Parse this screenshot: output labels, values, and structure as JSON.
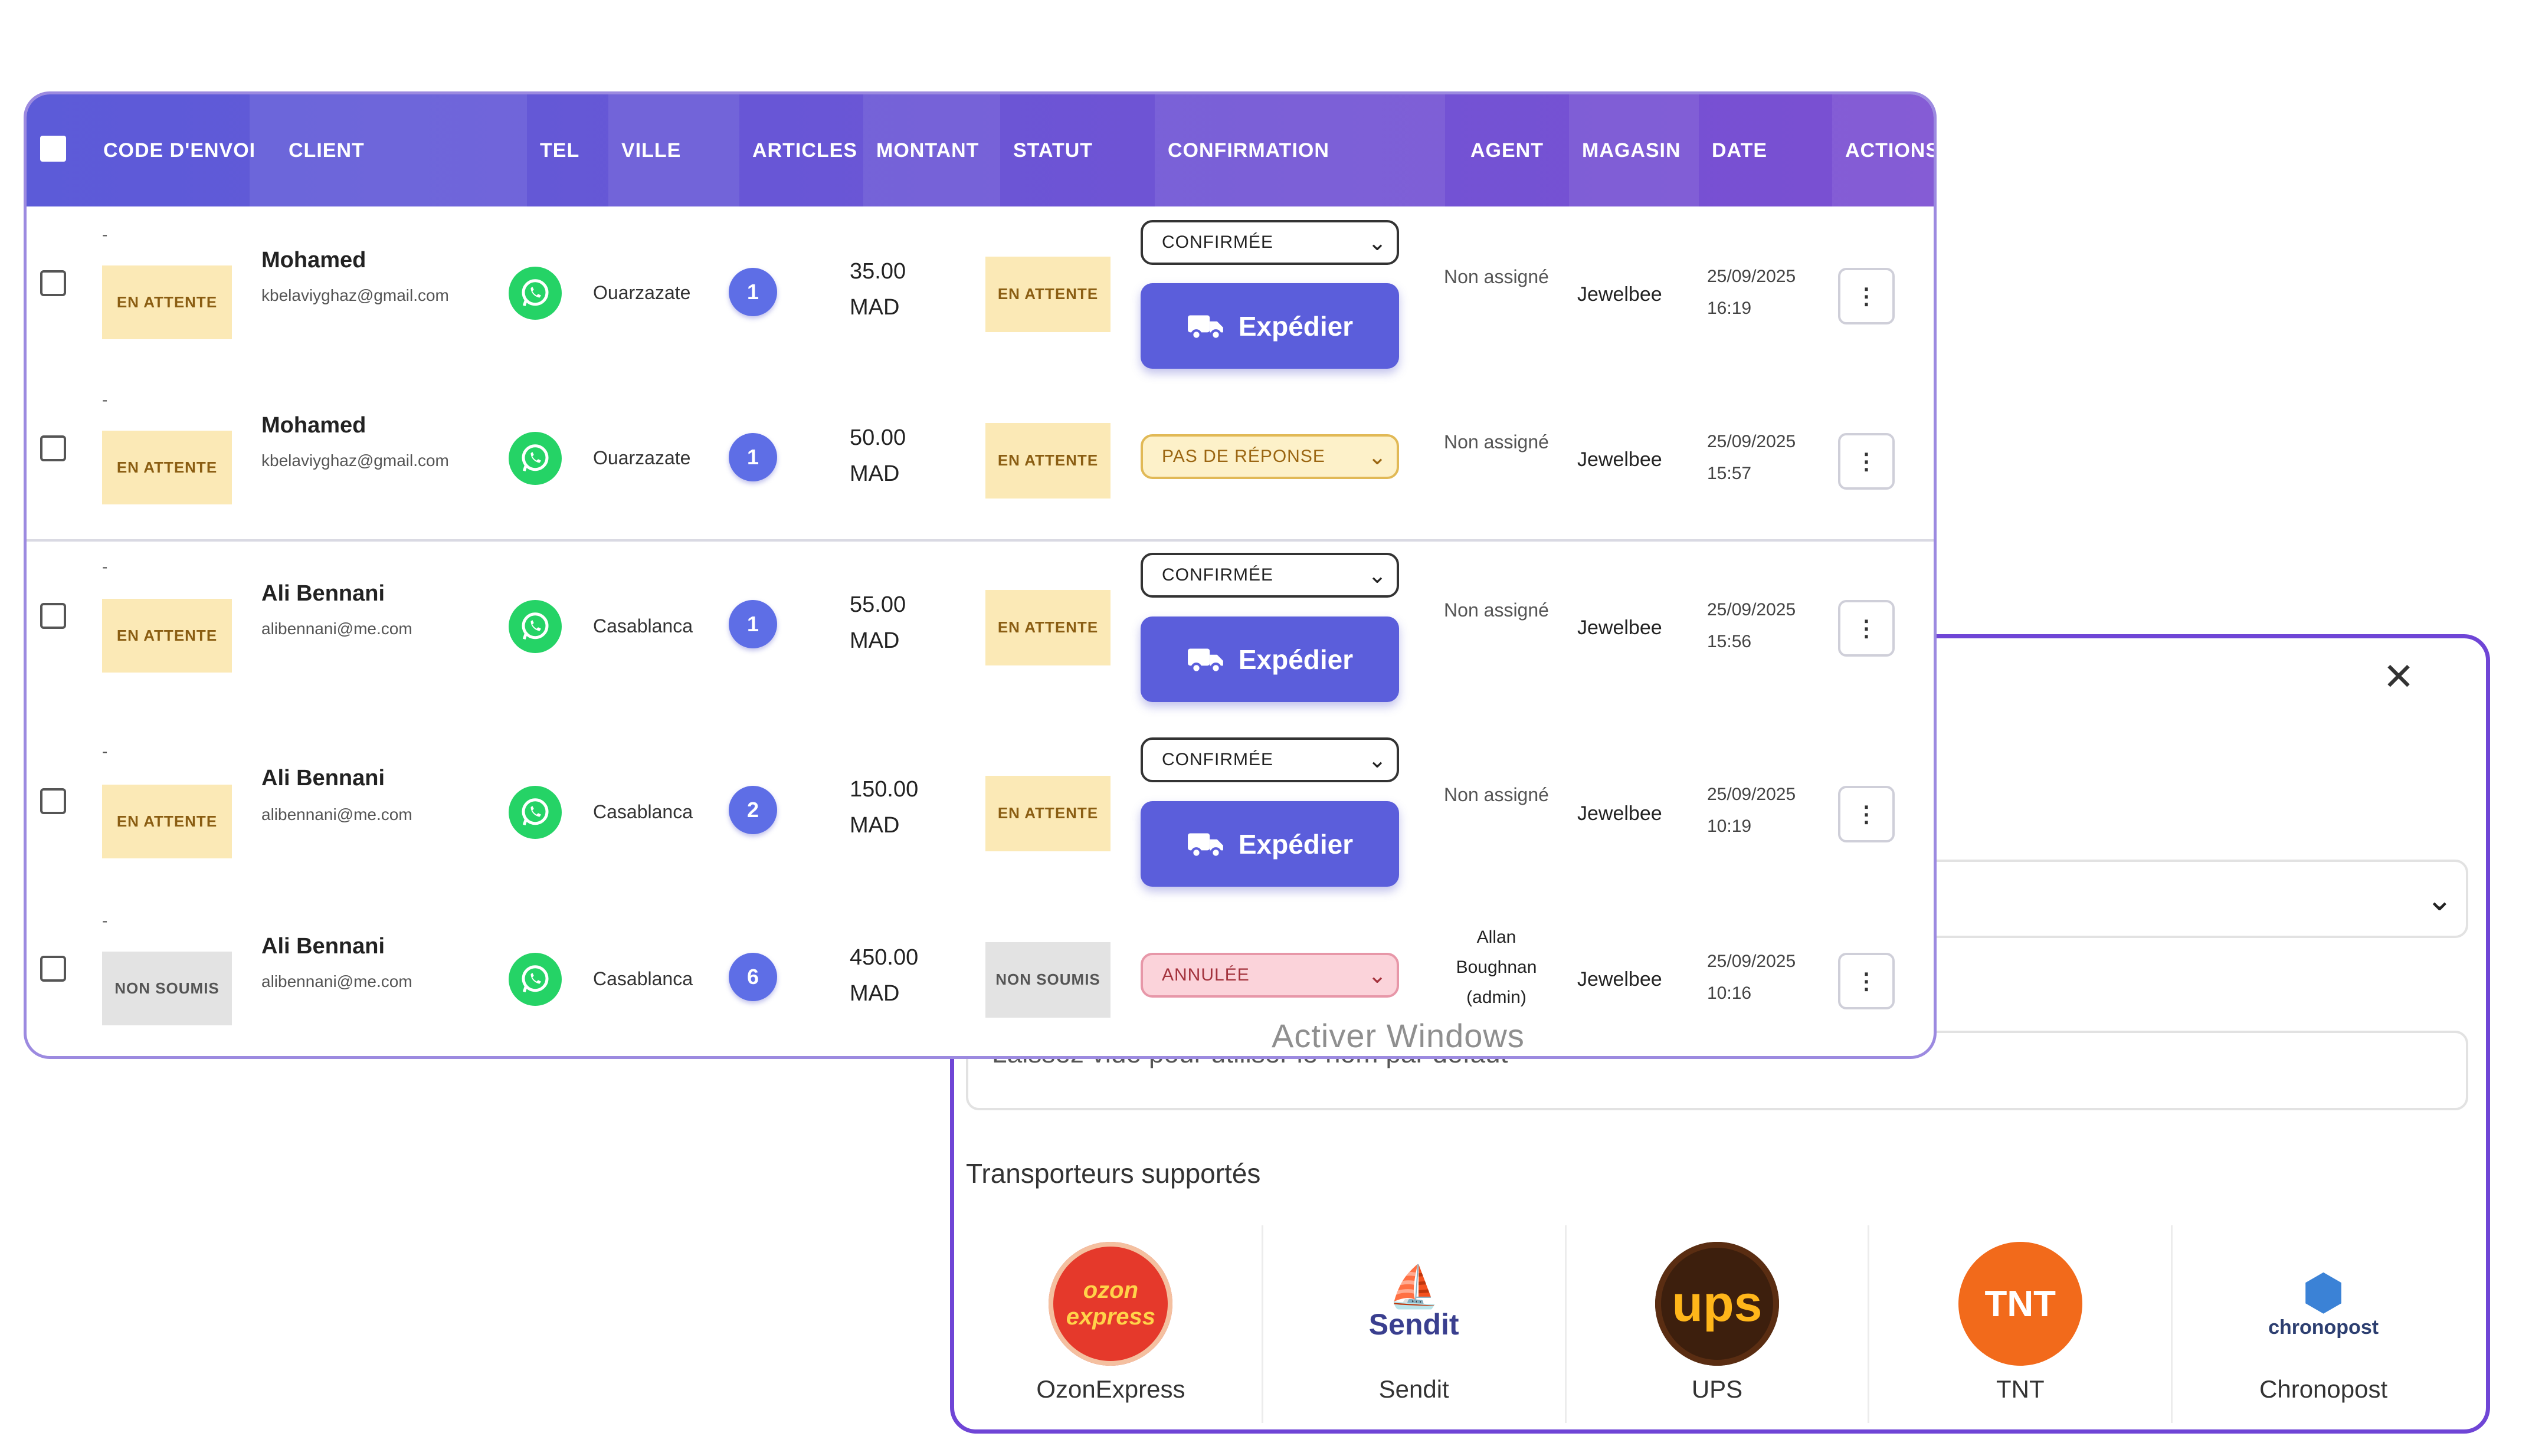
{
  "modal": {
    "close_icon": "close-icon",
    "name_placeholder": "Laissez vide pour utiliser le nom par défaut",
    "carriers_label": "Transporteurs supportés",
    "carriers": [
      {
        "name": "OzonExpress",
        "logo_text": "ozon express",
        "color": "#e5392b"
      },
      {
        "name": "Sendit",
        "logo_text": "Sendit",
        "color": "#3a3f8f"
      },
      {
        "name": "UPS",
        "logo_text": "ups",
        "color": "#5a2d12"
      },
      {
        "name": "TNT",
        "logo_text": "TNT",
        "color": "#f26a1b"
      },
      {
        "name": "Chronopost",
        "logo_text": "chronopost",
        "color": "#2c68c8"
      }
    ]
  },
  "table": {
    "headers": {
      "code": "Code d'envoi",
      "client": "Client",
      "tel": "Tel",
      "ville": "Ville",
      "articles": "Articles",
      "montant": "Montant",
      "statut": "Statut",
      "confirmation": "Confirmation",
      "agent": "Agent",
      "magasin": "Magasin",
      "date": "Date",
      "actions": "Actions"
    },
    "rows": [
      {
        "code": "-",
        "code_badge": "En attente",
        "name": "Mohamed",
        "email": "kbelaviyghaz@gmail.com",
        "city": "Ouarzazate",
        "articles": "1",
        "amount": "35.00",
        "currency": "MAD",
        "status": "En attente",
        "confirmation": "Confirmée",
        "ship_label": "Expédier",
        "agent": "Non assigné",
        "store": "Jewelbee",
        "date": "25/09/2025",
        "time": "16:19"
      },
      {
        "code": "-",
        "code_badge": "En attente",
        "name": "Mohamed",
        "email": "kbelaviyghaz@gmail.com",
        "city": "Ouarzazate",
        "articles": "1",
        "amount": "50.00",
        "currency": "MAD",
        "status": "En attente",
        "confirmation": "Pas de réponse",
        "agent": "Non assigné",
        "store": "Jewelbee",
        "date": "25/09/2025",
        "time": "15:57"
      },
      {
        "code": "-",
        "code_badge": "En attente",
        "name": "Ali Bennani",
        "email": "alibennani@me.com",
        "city": "Casablanca",
        "articles": "1",
        "amount": "55.00",
        "currency": "MAD",
        "status": "En attente",
        "confirmation": "Confirmée",
        "ship_label": "Expédier",
        "agent": "Non assigné",
        "store": "Jewelbee",
        "date": "25/09/2025",
        "time": "15:56"
      },
      {
        "code": "-",
        "code_badge": "En attente",
        "name": "Ali Bennani",
        "email": "alibennani@me.com",
        "city": "Casablanca",
        "articles": "2",
        "amount": "150.00",
        "currency": "MAD",
        "status": "En attente",
        "confirmation": "Confirmée",
        "ship_label": "Expédier",
        "agent": "Non assigné",
        "store": "Jewelbee",
        "date": "25/09/2025",
        "time": "10:19"
      },
      {
        "code": "-",
        "code_badge": "Non soumis",
        "name": "Ali Bennani",
        "email": "alibennani@me.com",
        "city": "Casablanca",
        "articles": "6",
        "amount": "450.00",
        "currency": "MAD",
        "status": "Non soumis",
        "confirmation": "Annulée",
        "agent": "Allan Boughnan (admin)",
        "store": "Jewelbee",
        "date": "25/09/2025",
        "time": "10:16"
      }
    ]
  },
  "watermark": "Activer Windows",
  "colors": {
    "header_gradient_start": "#5c5bd8",
    "header_gradient_end": "#7b4fd2",
    "ship_button": "#5b5edb",
    "whatsapp": "#25d366",
    "modal_border": "#6f45d6"
  }
}
